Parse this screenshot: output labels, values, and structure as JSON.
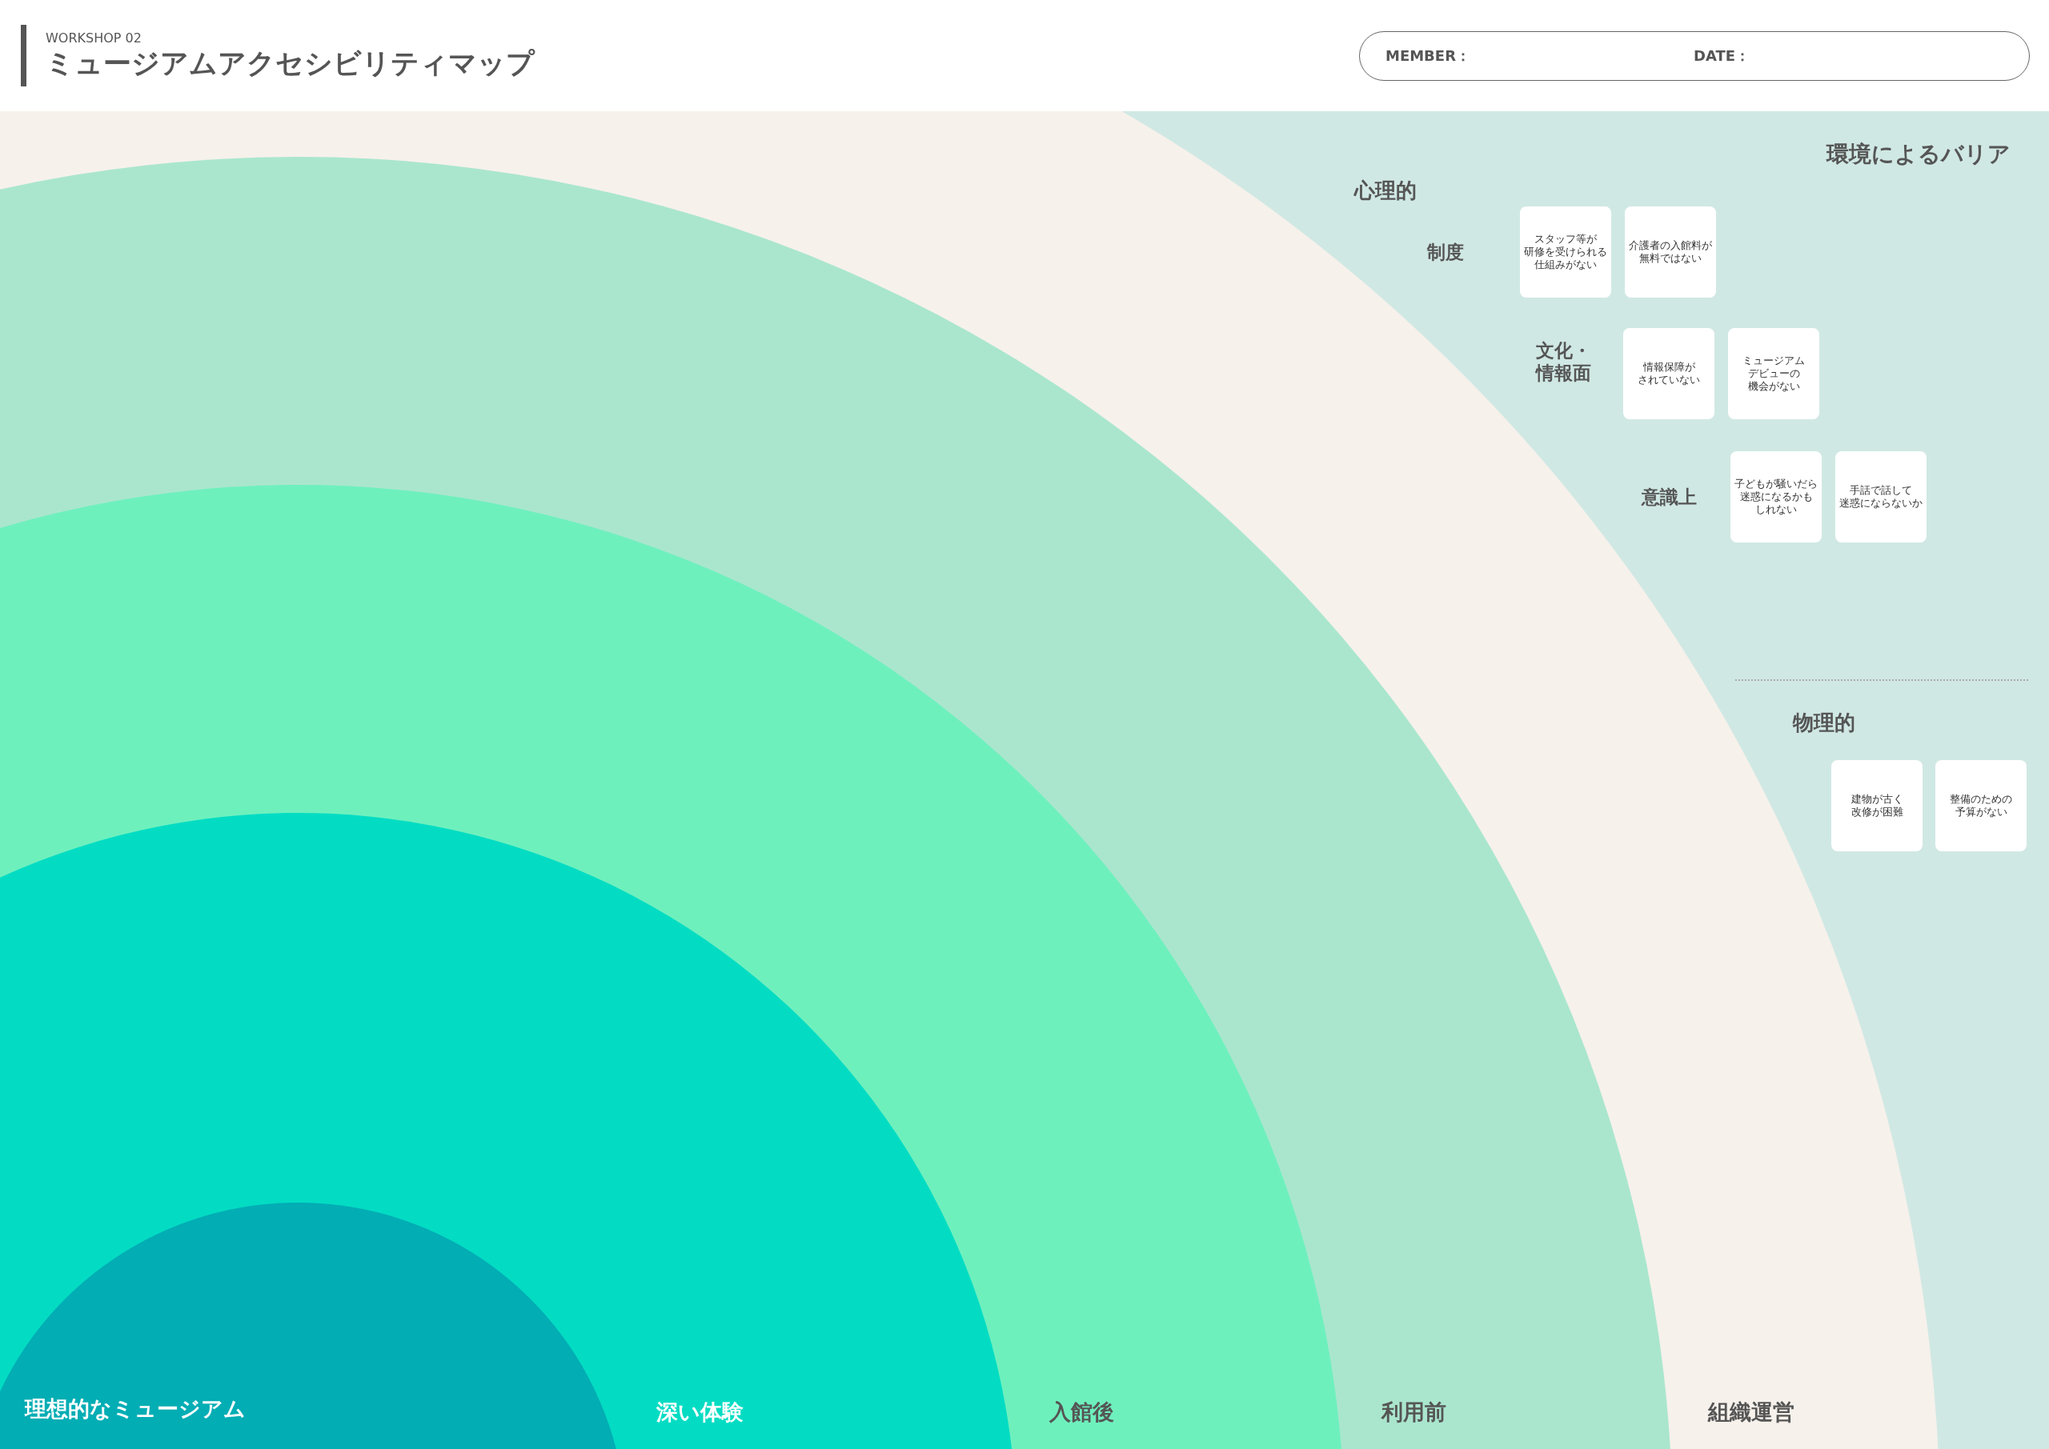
{
  "header": {
    "subtitle": "WORKSHOP 02",
    "title": "ミュージアムアクセシビリティマップ",
    "fields": [
      {
        "label": "MEMBER："
      },
      {
        "label": "DATE："
      }
    ]
  },
  "rings": [
    {
      "label": "理想的なミュージアム",
      "color": "#02adb4"
    },
    {
      "label": "深い体験",
      "color": "#03dcc3"
    },
    {
      "label": "入館後",
      "color": "#6ef0bd"
    },
    {
      "label": "利用前",
      "color": "#aae6ce"
    },
    {
      "label": "組織運営",
      "color": "#f6f1eb"
    }
  ],
  "barriers": {
    "title": "環境によるバリア",
    "groups": [
      {
        "title": "心理的",
        "categories": [
          {
            "label": [
              "制度"
            ],
            "notes": [
              [
                "スタッフ等が",
                "研修を受けられる",
                "仕組みがない"
              ],
              [
                "介護者の入館料が",
                "無料ではない"
              ]
            ]
          },
          {
            "label": [
              "文化・",
              "情報面"
            ],
            "notes": [
              [
                "情報保障が",
                "されていない"
              ],
              [
                "ミュージアム",
                "デビューの",
                "機会がない"
              ]
            ]
          },
          {
            "label": [
              "意識上"
            ],
            "notes": [
              [
                "子どもが騒いだら",
                "迷惑になるかも",
                "しれない"
              ],
              [
                "手話で話して",
                "迷惑にならないか"
              ]
            ]
          }
        ]
      },
      {
        "title": "物理的",
        "categories": [
          {
            "notes": [
              [
                "建物が古く",
                "改修が困難"
              ],
              [
                "整備のための",
                "予算がない"
              ]
            ]
          }
        ]
      }
    ]
  }
}
